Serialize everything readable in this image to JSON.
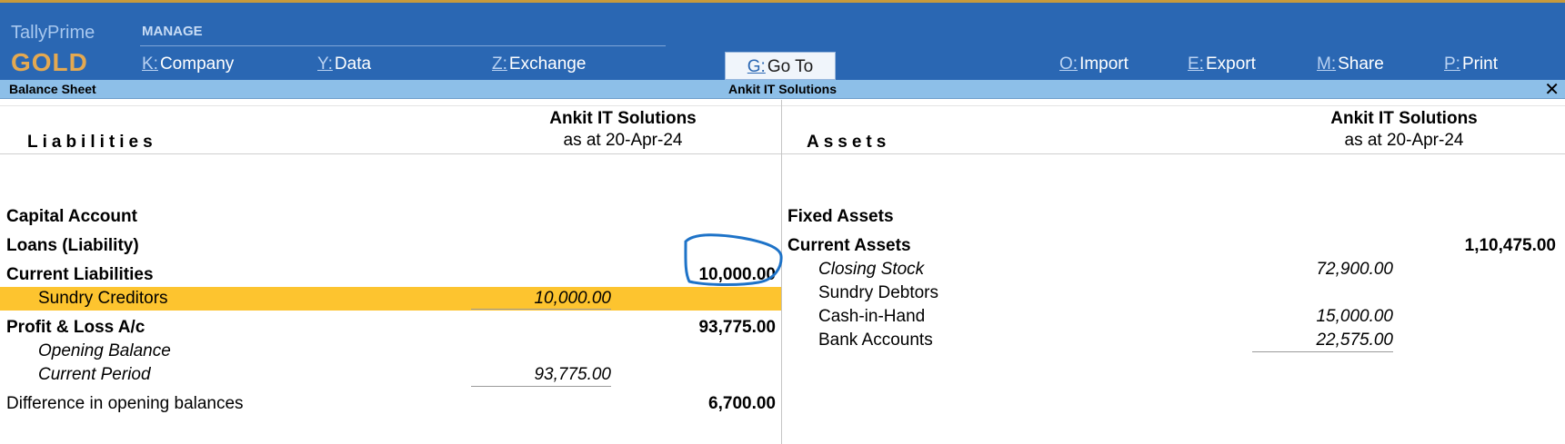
{
  "app": {
    "name": "TallyPrime",
    "tier": "GOLD",
    "manage_label": "MANAGE"
  },
  "menu": {
    "company": {
      "key": "K:",
      "label": "Company"
    },
    "data": {
      "key": "Y:",
      "label": "Data"
    },
    "exchange": {
      "key": "Z:",
      "label": "Exchange"
    },
    "goto": {
      "key": "G:",
      "label": "Go To"
    },
    "import": {
      "key": "O:",
      "label": "Import"
    },
    "export": {
      "key": "E:",
      "label": "Export"
    },
    "share": {
      "key": "M:",
      "label": "Share"
    },
    "print": {
      "key": "P:",
      "label": "Print"
    }
  },
  "titlebar": {
    "report": "Balance Sheet",
    "company": "Ankit IT Solutions",
    "close": "✕"
  },
  "liabilities": {
    "title": "Liabilities",
    "company": "Ankit IT Solutions",
    "date": "as at 20-Apr-24",
    "capital": {
      "label": "Capital Account"
    },
    "loans": {
      "label": "Loans (Liability)"
    },
    "current_liabilities": {
      "label": "Current Liabilities",
      "amount": "10,000.00"
    },
    "sundry_creditors": {
      "label": "Sundry Creditors",
      "amount": "10,000.00"
    },
    "pl": {
      "label": "Profit & Loss A/c",
      "amount": "93,775.00"
    },
    "opening_balance": {
      "label": "Opening Balance"
    },
    "current_period": {
      "label": "Current Period",
      "amount": "93,775.00"
    },
    "difference": {
      "label": "Difference in opening balances",
      "amount": "6,700.00"
    }
  },
  "assets": {
    "title": "Assets",
    "company": "Ankit IT Solutions",
    "date": "as at 20-Apr-24",
    "fixed": {
      "label": "Fixed Assets"
    },
    "current": {
      "label": "Current Assets",
      "amount": "1,10,475.00"
    },
    "closing_stock": {
      "label": "Closing Stock",
      "amount": "72,900.00"
    },
    "sundry_debtors": {
      "label": "Sundry Debtors"
    },
    "cash": {
      "label": "Cash-in-Hand",
      "amount": "15,000.00"
    },
    "bank": {
      "label": "Bank Accounts",
      "amount": "22,575.00"
    }
  },
  "colors": {
    "topbar": "#2a67b3",
    "titlebar": "#8dbfe8",
    "highlight": "#fdc42f",
    "annotation": "#1e73c8",
    "brand_tier": "#e4a951"
  }
}
